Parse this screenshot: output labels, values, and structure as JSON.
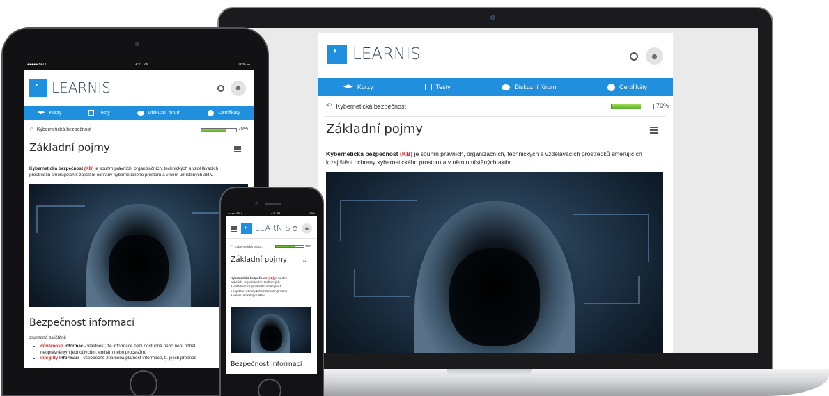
{
  "brand": {
    "name": "LEARNIS",
    "accent": "#1f8fde",
    "highlight": "#d42a2a"
  },
  "status": {
    "carrier": "BELL",
    "time": "4:21 PM",
    "battery": "100%"
  },
  "nav": {
    "items": [
      {
        "label": "Kurzy",
        "icon": "graduation-cap-icon"
      },
      {
        "label": "Testy",
        "icon": "checkbox-icon"
      },
      {
        "label": "Diskuzní fórum",
        "icon": "chat-bubbles-icon"
      },
      {
        "label": "Certifikáty",
        "icon": "badge-icon"
      }
    ]
  },
  "breadcrumb": {
    "label": "Kybernetická bezpečnost",
    "short": "Kybernetická bezp...",
    "progress_text": "70%",
    "progress_value": 0.7
  },
  "lesson": {
    "title": "Základní pojmy",
    "intro_term": "Kybernetická bezpečnost",
    "intro_abbr": "(KB)",
    "intro_rest": "je souhrn právních, organizačních, technických a vzdělávacích prostředků směřujících k zajištění ochrany kybernetického prostoru a v něm umístěných aktiv.",
    "phone_intro_1": "právních, organizačních, technických",
    "phone_intro_2": "a vzdělávacích prostředků směřujících",
    "phone_intro_3": "k zajištění ochrany kybernetického prostoru",
    "phone_intro_4": "a v něm umístěných aktiv.",
    "phone_intro_lead": "je souhrn",
    "tablet_intro_line1": "je souhrn právních, organizačních, technických a vzdělávacích",
    "tablet_intro_line2": "prostředků směřujících k zajištění ochrany kybernetického prostoru a v něm umístěných aktiv.",
    "laptop_intro_line1": "je souhrn právních, organizačních, technických a vzdělávacích prostředků směřujících",
    "laptop_intro_line2": "k zajištění ochrany kybernetického prostoru a v něm umístěných aktiv.",
    "section_title": "Bezpečnost informací",
    "section_intro": "znamená zajištění:",
    "bullets": [
      {
        "term": "důvěrnosti",
        "bold": "informací",
        "text": "- vlastnost, že informace není dostupná nebo není odhal",
        "text2": "neoprávněným jednotlivcům, entitám nebo procesům,"
      },
      {
        "term": "integrity",
        "bold": "informací",
        "text": "- všeobecně znamená platnost informace, tj. jejich přesnos"
      }
    ]
  }
}
